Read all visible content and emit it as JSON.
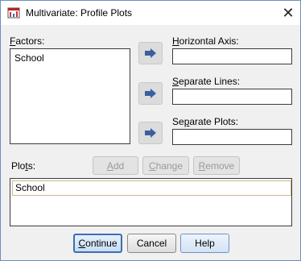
{
  "window": {
    "title": "Multivariate: Profile Plots",
    "close_symbol": "✕"
  },
  "factors": {
    "label": "Factors:",
    "items": [
      "School"
    ]
  },
  "horizontal_axis": {
    "label": "Horizontal Axis:",
    "value": ""
  },
  "separate_lines": {
    "label": "Separate Lines:",
    "value": ""
  },
  "separate_plots": {
    "label": "Separate Plots:",
    "value": ""
  },
  "plots": {
    "label": "Plots:",
    "items": [
      "School"
    ]
  },
  "plot_buttons": {
    "add": "Add",
    "change": "Change",
    "remove": "Remove"
  },
  "footer": {
    "continue": "Continue",
    "cancel": "Cancel",
    "help": "Help"
  },
  "icons": {
    "move_arrow": "arrow-right-icon",
    "app": "spss-app-icon"
  },
  "colors": {
    "arrow": "#3a5fa0",
    "default_button_border": "#3a6fb5"
  }
}
